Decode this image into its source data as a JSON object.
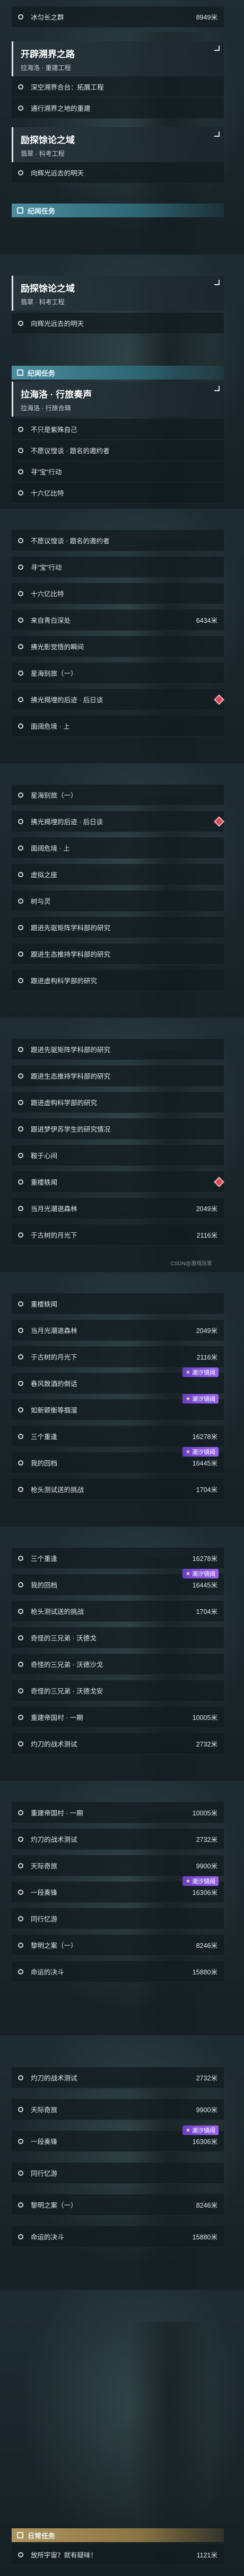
{
  "quests": {
    "q1": {
      "title": "开辟溯界之路",
      "subtitle": "拉海洛 · 重建工程"
    },
    "q2": {
      "title": "励探馀论之域",
      "subtitle": "翡翠 · 科考工程"
    },
    "q3": {
      "title": "拉海洛 · 行旅奏声",
      "subtitle": "拉海洛 · 行旅合辑"
    }
  },
  "categories": {
    "dispute": "纪闻任务",
    "daily": "日常任务"
  },
  "rows": {
    "r_top": {
      "label": "冰匀长之群",
      "dist": "8949米"
    },
    "r_q1a": {
      "label": "深空溯界合台：拓展工程"
    },
    "r_q1b": {
      "label": "通行溯界之地的重建"
    },
    "r_q2a": {
      "label": "向辉光远去的明天"
    },
    "r_q2b": {
      "label": "向辉光远去的明天"
    },
    "r3_1": {
      "label": "不只是紫殊自己"
    },
    "r3_2": {
      "label": "不愿议惶谈 · 题名的邀约者"
    },
    "r3_3": {
      "label": "寻“宝”行动"
    },
    "r3_4": {
      "label": "十六亿比特"
    },
    "r4_1": {
      "label": "不愿议惶谈 · 题名的邀约者"
    },
    "r4_2": {
      "label": "寻“宝”行动"
    },
    "r4_3": {
      "label": "十六亿比特"
    },
    "r4_4": {
      "label": "来自青白深处",
      "dist": "6434米"
    },
    "r4_5": {
      "label": "拂光影觉悟的瞬间"
    },
    "r4_6": {
      "label": "星海别旅（一）"
    },
    "r4_7": {
      "label": "拂光揭埋的后迹 · 后日谈"
    },
    "r4_8": {
      "label": "面阔危境 · 上"
    },
    "r5_1": {
      "label": "星海别旅（一）"
    },
    "r5_2": {
      "label": "拂光揭埋的后迹 · 后日谈"
    },
    "r5_3": {
      "label": "面阔危境 · 上"
    },
    "r5_4": {
      "label": "虚拟之座"
    },
    "r5_5": {
      "label": "树与灵"
    },
    "r5_6": {
      "label": "跟进先驱矩阵学科部的研究"
    },
    "r5_7": {
      "label": "跟进生态推持学科部的研究"
    },
    "r5_8": {
      "label": "跟进虚构科学部的研究"
    },
    "r6_1": {
      "label": "跟进先驱矩阵学科部的研究"
    },
    "r6_2": {
      "label": "跟进生态推持学科部的研究"
    },
    "r6_3": {
      "label": "跟进虚构科学部的研究"
    },
    "r6_4": {
      "label": "跟进梦伊苏学生的研究情况"
    },
    "r6_5": {
      "label": "鞍于心间"
    },
    "r6_6": {
      "label": "重楼轶闻"
    },
    "r6_7": {
      "label": "当月光潮退森林",
      "dist": "2049米"
    },
    "r6_8": {
      "label": "于古树的月光下",
      "dist": "2116米"
    },
    "r7_1": {
      "label": "重楼轶闻"
    },
    "r7_2": {
      "label": "当月光潮退森林",
      "dist": "2049米"
    },
    "r7_3": {
      "label": "于古树的月光下",
      "dist": "2116米"
    },
    "r7_4": {
      "label": "春风致酒的倒话"
    },
    "r7_5": {
      "label": "如新颖衡等掴溜"
    },
    "r7_6": {
      "label": "三个重逢",
      "dist": "16278米"
    },
    "r7_7": {
      "label": "我的回档",
      "dist": "16445米"
    },
    "r7_8": {
      "label": "枪头测试送的挑战",
      "dist": "1704米"
    },
    "r8_1": {
      "label": "三个重逢",
      "dist": "16278米"
    },
    "r8_2": {
      "label": "我的回档",
      "dist": "16445米"
    },
    "r8_3": {
      "label": "枪头测试送的挑战",
      "dist": "1704米"
    },
    "r8_4": {
      "label": "奇怪的三兄弟 · 沃德戈"
    },
    "r8_5": {
      "label": "奇怪的三兄弟 · 沃德沙戈"
    },
    "r8_6": {
      "label": "奇怪的三兄弟 · 沃德戈安"
    },
    "r8_7": {
      "label": "重建帝国村 · 一期",
      "dist": "10005米"
    },
    "r8_8": {
      "label": "灼刀的战术测试",
      "dist": "2732米"
    },
    "r9_1": {
      "label": "重建帝国村 · 一期",
      "dist": "10005米"
    },
    "r9_2": {
      "label": "灼刀的战术测试",
      "dist": "2732米"
    },
    "r9_3": {
      "label": "天际奇旅",
      "dist": "9900米"
    },
    "r9_4": {
      "label": "一段奏锋",
      "dist": "16306米"
    },
    "r9_5": {
      "label": "同行忆游"
    },
    "r9_6": {
      "label": "黎明之案（一）",
      "dist": "8246米"
    },
    "r9_7": {
      "label": "命运的决斗",
      "dist": "15880米"
    },
    "r10_1": {
      "label": "灼刀的战术测试",
      "dist": "2732米"
    },
    "r10_2": {
      "label": "天际奇旅",
      "dist": "9900米"
    },
    "r10_3": {
      "label": "一段奏锋",
      "dist": "16306米"
    },
    "r10_4": {
      "label": "同行忆游"
    },
    "r10_5": {
      "label": "黎明之案（一）",
      "dist": "8246米"
    },
    "r10_6": {
      "label": "命运的决斗",
      "dist": "15880米"
    },
    "r10_7": {
      "label": "放所宇宙？就有疑味！",
      "dist": "1121米"
    }
  },
  "badge": {
    "label": "潮汐镜阈"
  },
  "watermark": "CSDN@游戏玩家",
  "colors": {
    "accent": "#4a8ea0",
    "marker": "#d44a5a",
    "badge": "#7a4fd8"
  }
}
